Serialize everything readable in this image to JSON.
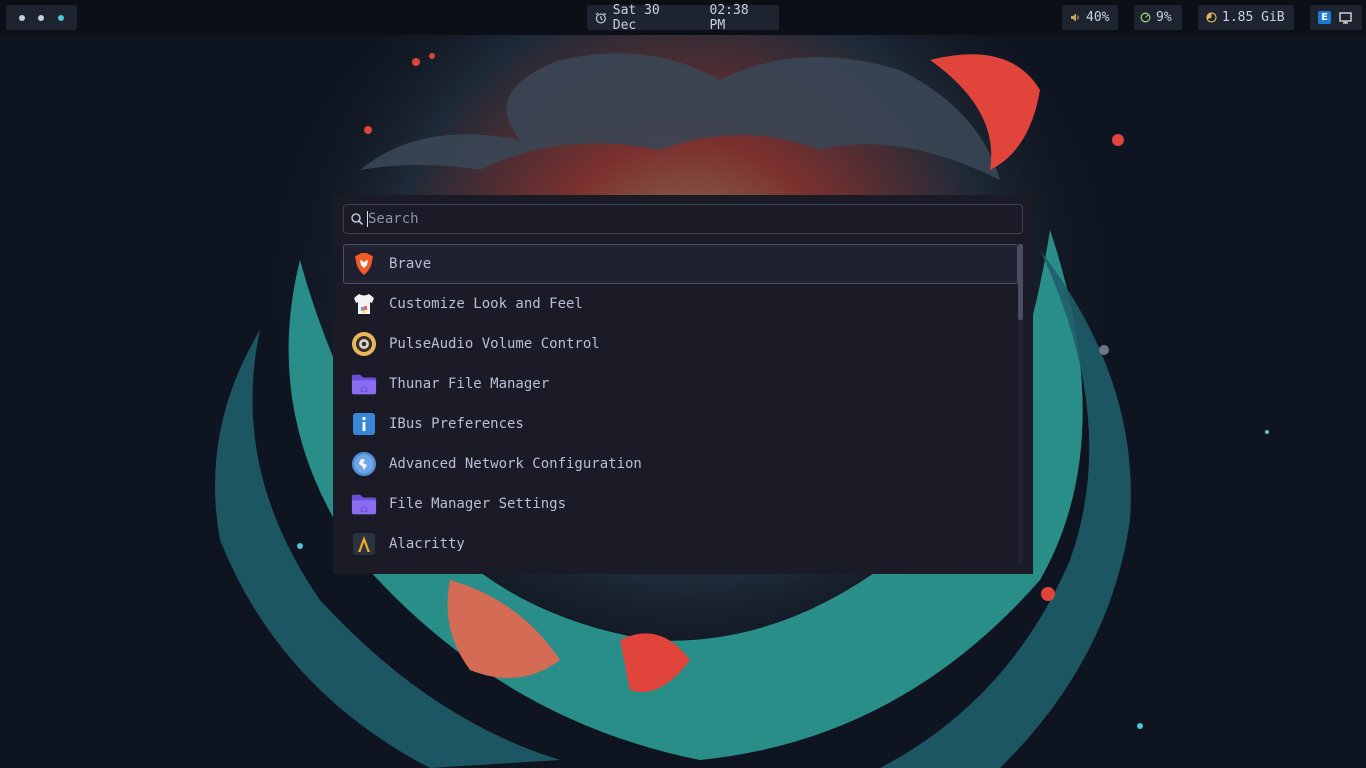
{
  "colors": {
    "bar_bg": "#0c0f16",
    "chip_bg": "#1e2330",
    "accent": "#4fc3d9",
    "launcher_bg": "#1a1b26",
    "text": "#b9bfd6"
  },
  "topbar": {
    "workspaces": [
      "workspace-1",
      "workspace-2",
      "workspace-3"
    ],
    "active_workspace": 3,
    "clock": {
      "icon": "alarm-clock-icon",
      "date": "Sat 30 Dec",
      "time": "02:38 PM"
    },
    "volume": {
      "icon": "speaker-icon",
      "value": "40%"
    },
    "cpu": {
      "icon": "cpu-gauge-icon",
      "value": "9%"
    },
    "memory": {
      "icon": "memory-pie-icon",
      "value": "1.85 GiB"
    },
    "tray": [
      {
        "icon": "e-app-icon",
        "label": "E"
      },
      {
        "icon": "monitor-icon"
      }
    ]
  },
  "launcher": {
    "search": {
      "placeholder": "Search",
      "value": ""
    },
    "items": [
      {
        "label": "Brave",
        "icon": "brave-icon",
        "selected": true
      },
      {
        "label": "Customize Look and Feel",
        "icon": "tshirt-icon"
      },
      {
        "label": "PulseAudio Volume Control",
        "icon": "speaker-cone-icon"
      },
      {
        "label": "Thunar File Manager",
        "icon": "folder-icon"
      },
      {
        "label": "IBus Preferences",
        "icon": "info-icon"
      },
      {
        "label": "Advanced Network Configuration",
        "icon": "network-globe-icon"
      },
      {
        "label": "File Manager Settings",
        "icon": "folder-icon"
      },
      {
        "label": "Alacritty",
        "icon": "alacritty-icon"
      }
    ]
  }
}
